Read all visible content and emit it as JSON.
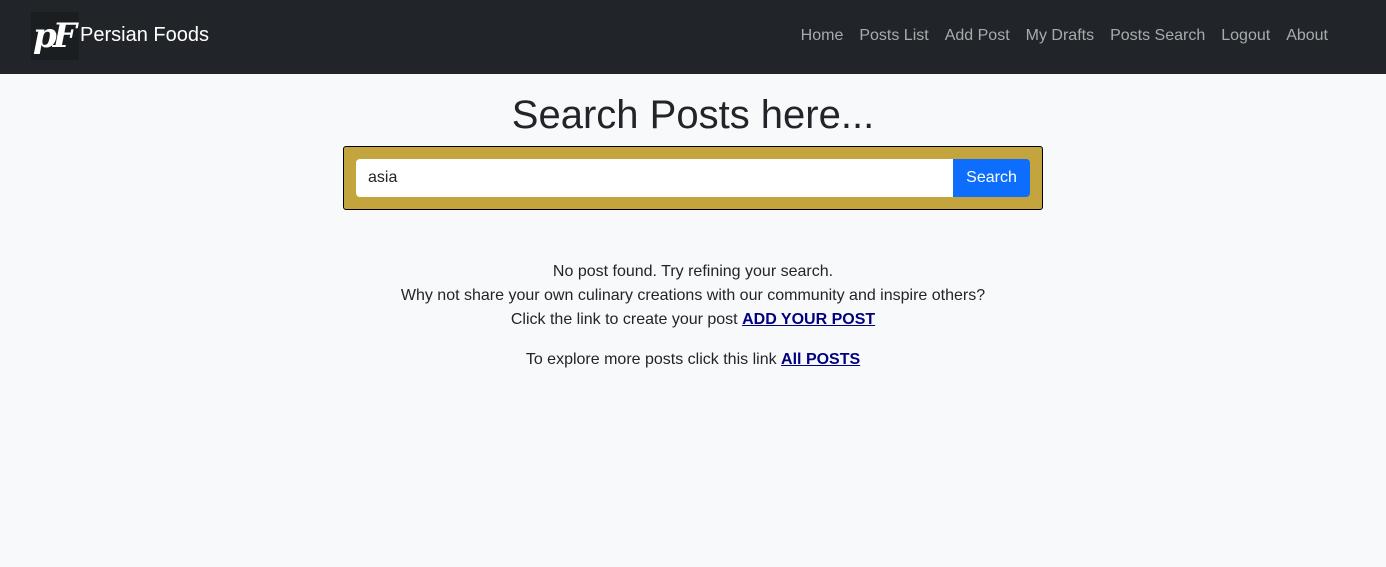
{
  "navbar": {
    "logo_text": "pF",
    "brand_name": "Persian Foods",
    "links": [
      "Home",
      "Posts List",
      "Add Post",
      "My Drafts",
      "Posts Search",
      "Logout",
      "About"
    ]
  },
  "main": {
    "title": "Search Posts here...",
    "search": {
      "value": "asia",
      "button_label": "Search"
    },
    "result": {
      "not_found": "No post found. Try refining your search.",
      "share_prompt": "Why not share your own culinary creations with our community and inspire others?",
      "create_prefix": "Click the link to create your post",
      "create_link": "ADD YOUR POST",
      "explore_prefix": "To explore more posts click this link",
      "explore_link": "All POSTS"
    }
  },
  "colors": {
    "navbar_bg": "#212529",
    "search_box_bg": "#c4a43d",
    "search_button_bg": "#0d6efd",
    "link_color": "#000080",
    "page_bg": "#f8f9fa"
  }
}
